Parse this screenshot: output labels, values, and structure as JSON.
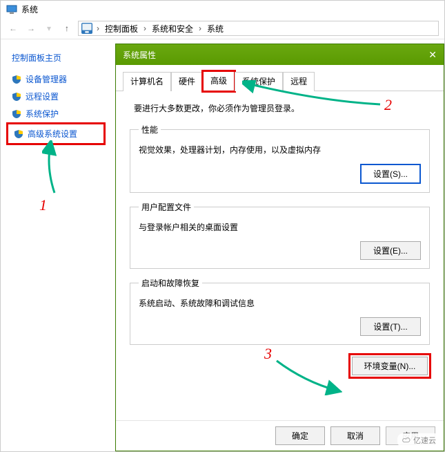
{
  "window": {
    "title": "系统"
  },
  "breadcrumb": {
    "items": [
      "控制面板",
      "系统和安全",
      "系统"
    ]
  },
  "sidebar": {
    "title": "控制面板主页",
    "items": [
      {
        "label": "设备管理器"
      },
      {
        "label": "远程设置"
      },
      {
        "label": "系统保护"
      },
      {
        "label": "高级系统设置"
      }
    ]
  },
  "dialog": {
    "title": "系统属性",
    "tabs": [
      "计算机名",
      "硬件",
      "高级",
      "系统保护",
      "远程"
    ],
    "active_tab": "高级",
    "notice": "要进行大多数更改，你必须作为管理员登录。",
    "groups": {
      "performance": {
        "legend": "性能",
        "desc": "视觉效果，处理器计划，内存使用，以及虚拟内存",
        "button": "设置(S)..."
      },
      "user_profiles": {
        "legend": "用户配置文件",
        "desc": "与登录帐户相关的桌面设置",
        "button": "设置(E)..."
      },
      "startup": {
        "legend": "启动和故障恢复",
        "desc": "系统启动、系统故障和调试信息",
        "button": "设置(T)..."
      }
    },
    "env_button": "环境变量(N)...",
    "footer": {
      "ok": "确定",
      "cancel": "取消",
      "apply": "应用"
    }
  },
  "annotations": {
    "one": "1",
    "two": "2",
    "three": "3"
  },
  "watermark": "亿速云"
}
